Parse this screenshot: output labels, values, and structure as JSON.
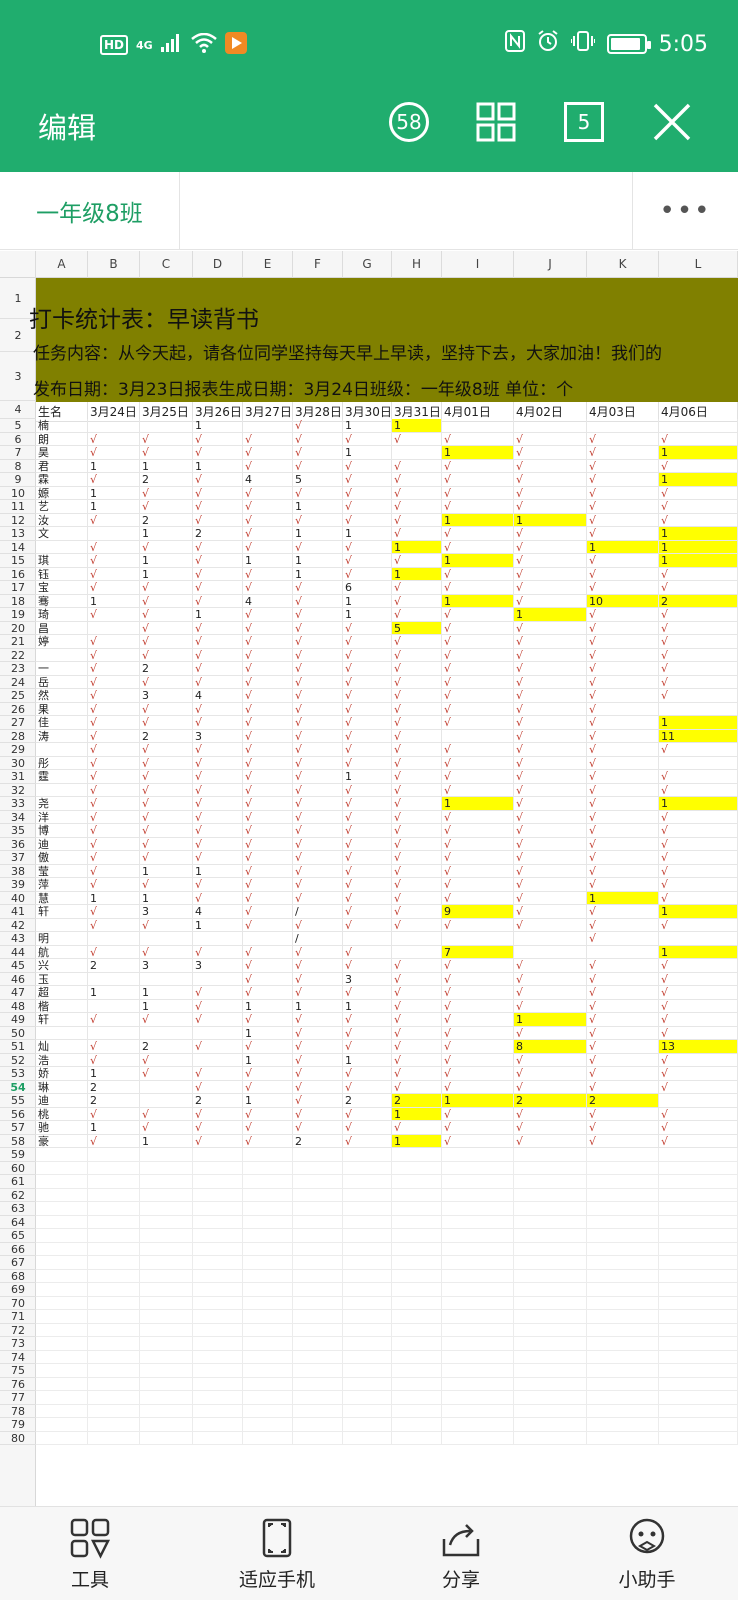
{
  "status": {
    "network": "4G",
    "hd": "HD",
    "time": "5:05",
    "battery_level": 0.9
  },
  "toolbar": {
    "title": "编辑",
    "badge_count": "58",
    "page_count": "5"
  },
  "sheet": {
    "tab_name": "一年级8班",
    "more": "•••"
  },
  "columns": [
    "A",
    "B",
    "C",
    "D",
    "E",
    "F",
    "G",
    "H",
    "I",
    "J",
    "K",
    "L"
  ],
  "band": {
    "line1": "打卡统计表：早读背书",
    "line2": "任务内容：从今天起，请各位同学坚持每天早上早读，坚持下去，大家加油！我们的",
    "line3": "发布日期：3月23日报表生成日期：3月24日班级：一年级8班 单位：个"
  },
  "header_row": [
    "生名",
    "3月24日",
    "3月25日",
    "3月26日",
    "3月27日",
    "3月28日",
    "3月30日",
    "3月31日",
    "4月01日",
    "4月02日",
    "4月03日",
    "4月06日"
  ],
  "rows": [
    [
      "楠",
      "",
      "",
      "1",
      "",
      "√",
      "1",
      "1",
      "",
      "",
      "",
      ""
    ],
    [
      "朗",
      "√",
      "√",
      "√",
      "√",
      "√",
      "√",
      "√",
      "√",
      "√",
      "√",
      "√"
    ],
    [
      "昊",
      "√",
      "√",
      "√",
      "√",
      "√",
      "1",
      "",
      "1",
      "√",
      "√",
      "1"
    ],
    [
      "君",
      "1",
      "1",
      "1",
      "√",
      "√",
      "√",
      "√",
      "√",
      "√",
      "√",
      "√"
    ],
    [
      "霖",
      "√",
      "2",
      "√",
      "4",
      "5",
      "√",
      "√",
      "√",
      "√",
      "√",
      "1"
    ],
    [
      "嫄",
      "1",
      "√",
      "√",
      "√",
      "√",
      "√",
      "√",
      "√",
      "√",
      "√",
      "√"
    ],
    [
      "艺",
      "1",
      "√",
      "√",
      "√",
      "1",
      "√",
      "√",
      "√",
      "√",
      "√",
      "√"
    ],
    [
      "汝",
      "√",
      "2",
      "√",
      "√",
      "√",
      "√",
      "√",
      "1",
      "1",
      "√",
      "√"
    ],
    [
      "文",
      "",
      "1",
      "2",
      "√",
      "1",
      "1",
      "√",
      "√",
      "√",
      "√",
      "1"
    ],
    [
      "",
      "√",
      "√",
      "√",
      "√",
      "√",
      "√",
      "1",
      "√",
      "√",
      "1",
      "1"
    ],
    [
      "琪",
      "√",
      "1",
      "√",
      "1",
      "1",
      "√",
      "√",
      "1",
      "√",
      "√",
      "1"
    ],
    [
      "钰",
      "√",
      "1",
      "√",
      "√",
      "1",
      "√",
      "1",
      "√",
      "√",
      "√",
      "√"
    ],
    [
      "宝",
      "√",
      "√",
      "√",
      "√",
      "√",
      "6",
      "√",
      "√",
      "√",
      "√",
      "√"
    ],
    [
      "骞",
      "1",
      "√",
      "√",
      "4",
      "√",
      "1",
      "√",
      "1",
      "√",
      "10",
      "2"
    ],
    [
      "琦",
      "√",
      "√",
      "1",
      "√",
      "√",
      "1",
      "√",
      "√",
      "1",
      "√",
      "√"
    ],
    [
      "昌",
      "",
      "√",
      "√",
      "√",
      "√",
      "√",
      "5",
      "√",
      "√",
      "√",
      "√"
    ],
    [
      "婷",
      "√",
      "√",
      "√",
      "√",
      "√",
      "√",
      "√",
      "√",
      "√",
      "√",
      "√"
    ],
    [
      "",
      "√",
      "√",
      "√",
      "√",
      "√",
      "√",
      "√",
      "√",
      "√",
      "√",
      "√"
    ],
    [
      "一",
      "√",
      "2",
      "√",
      "√",
      "√",
      "√",
      "√",
      "√",
      "√",
      "√",
      "√"
    ],
    [
      "岳",
      "√",
      "√",
      "√",
      "√",
      "√",
      "√",
      "√",
      "√",
      "√",
      "√",
      "√"
    ],
    [
      "然",
      "√",
      "3",
      "4",
      "√",
      "√",
      "√",
      "√",
      "√",
      "√",
      "√",
      "√"
    ],
    [
      "果",
      "√",
      "√",
      "√",
      "√",
      "√",
      "√",
      "√",
      "√",
      "√",
      "√",
      ""
    ],
    [
      "佳",
      "√",
      "√",
      "√",
      "√",
      "√",
      "√",
      "√",
      "√",
      "√",
      "√",
      "1"
    ],
    [
      "涛",
      "√",
      "2",
      "3",
      "√",
      "√",
      "√",
      "√",
      "",
      "√",
      "√",
      "11"
    ],
    [
      "",
      "√",
      "√",
      "√",
      "√",
      "√",
      "√",
      "√",
      "√",
      "√",
      "√",
      "√"
    ],
    [
      "彤",
      "√",
      "√",
      "√",
      "√",
      "√",
      "√",
      "√",
      "√",
      "√",
      "√",
      ""
    ],
    [
      "霆",
      "√",
      "√",
      "√",
      "√",
      "√",
      "1",
      "√",
      "√",
      "√",
      "√",
      "√"
    ],
    [
      "",
      "√",
      "√",
      "√",
      "√",
      "√",
      "√",
      "√",
      "√",
      "√",
      "√",
      "√"
    ],
    [
      "尧",
      "√",
      "√",
      "√",
      "√",
      "√",
      "√",
      "√",
      "1",
      "√",
      "√",
      "1"
    ],
    [
      "洋",
      "√",
      "√",
      "√",
      "√",
      "√",
      "√",
      "√",
      "√",
      "√",
      "√",
      "√"
    ],
    [
      "博",
      "√",
      "√",
      "√",
      "√",
      "√",
      "√",
      "√",
      "√",
      "√",
      "√",
      "√"
    ],
    [
      "迪",
      "√",
      "√",
      "√",
      "√",
      "√",
      "√",
      "√",
      "√",
      "√",
      "√",
      "√"
    ],
    [
      "傲",
      "√",
      "√",
      "√",
      "√",
      "√",
      "√",
      "√",
      "√",
      "√",
      "√",
      "√"
    ],
    [
      "莹",
      "√",
      "1",
      "1",
      "√",
      "√",
      "√",
      "√",
      "√",
      "√",
      "√",
      "√"
    ],
    [
      "萍",
      "√",
      "√",
      "√",
      "√",
      "√",
      "√",
      "√",
      "√",
      "√",
      "√",
      "√"
    ],
    [
      "慧",
      "1",
      "1",
      "√",
      "√",
      "√",
      "√",
      "√",
      "√",
      "√",
      "1",
      "√"
    ],
    [
      "轩",
      "√",
      "3",
      "4",
      "√",
      "/",
      "√",
      "√",
      "9",
      "√",
      "√",
      "1"
    ],
    [
      "",
      "√",
      "√",
      "1",
      "√",
      "√",
      "√",
      "√",
      "√",
      "√",
      "√",
      "√"
    ],
    [
      "明",
      "",
      "",
      "",
      "",
      "/",
      "",
      "",
      "",
      "",
      "√",
      ""
    ],
    [
      "航",
      "√",
      "√",
      "√",
      "√",
      "√",
      "√",
      "",
      "7",
      "",
      "",
      "1"
    ],
    [
      "兴",
      "2",
      "3",
      "3",
      "√",
      "√",
      "√",
      "√",
      "√",
      "√",
      "√",
      "√"
    ],
    [
      "玉",
      "",
      "",
      "",
      "√",
      "√",
      "3",
      "√",
      "√",
      "√",
      "√",
      "√"
    ],
    [
      "超",
      "1",
      "1",
      "√",
      "√",
      "√",
      "√",
      "√",
      "√",
      "√",
      "√",
      "√"
    ],
    [
      "楷",
      "",
      "1",
      "√",
      "1",
      "1",
      "1",
      "√",
      "√",
      "√",
      "√",
      "√"
    ],
    [
      "轩",
      "√",
      "√",
      "√",
      "√",
      "√",
      "√",
      "√",
      "√",
      "1",
      "√",
      "√"
    ],
    [
      "",
      "",
      "",
      "",
      "1",
      "√",
      "√",
      "√",
      "√",
      "√",
      "√",
      "√"
    ],
    [
      "灿",
      "√",
      "2",
      "√",
      "√",
      "√",
      "√",
      "√",
      "√",
      "8",
      "√",
      "13"
    ],
    [
      "浩",
      "√",
      "√",
      "",
      "1",
      "√",
      "1",
      "√",
      "√",
      "√",
      "√",
      "√"
    ],
    [
      "娇",
      "1",
      "√",
      "√",
      "√",
      "√",
      "√",
      "√",
      "√",
      "√",
      "√",
      "√"
    ],
    [
      "琳",
      "2",
      "",
      "√",
      "√",
      "√",
      "√",
      "√",
      "√",
      "√",
      "√",
      "√"
    ],
    [
      "迪",
      "2",
      "",
      "2",
      "1",
      "√",
      "2",
      "2",
      "1",
      "2",
      "2",
      ""
    ],
    [
      "桃",
      "√",
      "√",
      "√",
      "√",
      "√",
      "√",
      "1",
      "√",
      "√",
      "√",
      "√"
    ],
    [
      "驰",
      "1",
      "√",
      "√",
      "√",
      "√",
      "√",
      "√",
      "√",
      "√",
      "√",
      "√"
    ],
    [
      "豪",
      "√",
      "1",
      "√",
      "√",
      "2",
      "√",
      "1",
      "√",
      "√",
      "√",
      "√"
    ]
  ],
  "highlights": [
    [
      0,
      7
    ],
    [
      2,
      8
    ],
    [
      2,
      11
    ],
    [
      4,
      11
    ],
    [
      7,
      8
    ],
    [
      7,
      9
    ],
    [
      8,
      11
    ],
    [
      9,
      7
    ],
    [
      9,
      10
    ],
    [
      9,
      11
    ],
    [
      10,
      8
    ],
    [
      10,
      11
    ],
    [
      11,
      7
    ],
    [
      13,
      8
    ],
    [
      13,
      10
    ],
    [
      13,
      11
    ],
    [
      14,
      9
    ],
    [
      15,
      7
    ],
    [
      22,
      11
    ],
    [
      23,
      11
    ],
    [
      28,
      8
    ],
    [
      28,
      11
    ],
    [
      35,
      10
    ],
    [
      36,
      8
    ],
    [
      36,
      11
    ],
    [
      39,
      8
    ],
    [
      39,
      11
    ],
    [
      44,
      9
    ],
    [
      46,
      9
    ],
    [
      46,
      11
    ],
    [
      50,
      7
    ],
    [
      50,
      8
    ],
    [
      50,
      9
    ],
    [
      50,
      10
    ],
    [
      51,
      7
    ],
    [
      53,
      7
    ]
  ],
  "row_numbers": [
    "1",
    "2",
    "3",
    "4",
    "5",
    "6",
    "7",
    "8",
    "9",
    "10",
    "11",
    "12",
    "13",
    "14",
    "15",
    "16",
    "17",
    "18",
    "19",
    "20",
    "21",
    "22",
    "23",
    "24",
    "25",
    "26",
    "27",
    "28",
    "29",
    "30",
    "31",
    "32",
    "33",
    "34",
    "35",
    "36",
    "37",
    "38",
    "39",
    "40",
    "41",
    "42",
    "43",
    "44",
    "45",
    "46",
    "47",
    "48",
    "49",
    "50",
    "51",
    "52",
    "53",
    "54",
    "55",
    "56",
    "57",
    "58",
    "59",
    "60",
    "61",
    "62",
    "63",
    "64",
    "65",
    "66",
    "67",
    "68",
    "69",
    "70",
    "71",
    "72",
    "73",
    "74",
    "75",
    "76",
    "77",
    "78",
    "79",
    "80"
  ],
  "active_row": "54",
  "bottom_nav": {
    "tools": "工具",
    "fit": "适应手机",
    "share": "分享",
    "assistant": "小助手"
  }
}
